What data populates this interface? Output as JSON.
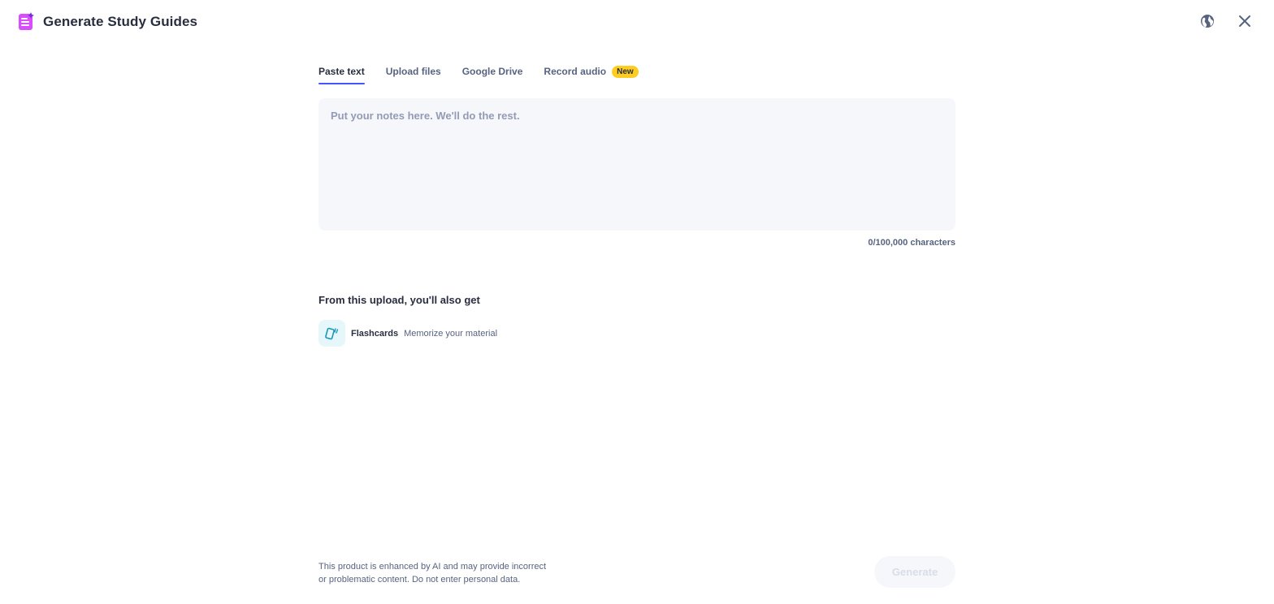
{
  "header": {
    "title": "Generate Study Guides",
    "logo_icon": "study-guide-icon",
    "brand_color": "#d94cff"
  },
  "tabs": [
    {
      "label": "Paste text",
      "active": true
    },
    {
      "label": "Upload files",
      "active": false
    },
    {
      "label": "Google Drive",
      "active": false
    },
    {
      "label": "Record audio",
      "active": false,
      "badge": "New"
    }
  ],
  "notes": {
    "placeholder": "Put your notes here. We'll do the rest.",
    "value": "",
    "char_count": "0/100,000 characters"
  },
  "also_get": {
    "heading": "From this upload, you'll also get",
    "items": [
      {
        "name": "Flashcards",
        "description": "Memorize your material",
        "icon": "flashcards-icon"
      }
    ]
  },
  "footer": {
    "disclaimer_line1": "This product is enhanced by AI and may provide incorrect",
    "disclaimer_line2": "or problematic content. Do not enter personal data.",
    "generate_label": "Generate"
  },
  "colors": {
    "accent": "#4255ff",
    "badge": "#ffcd1f",
    "textbox_bg": "#f6f7fb",
    "flashcard_icon": "#1b98b8"
  }
}
